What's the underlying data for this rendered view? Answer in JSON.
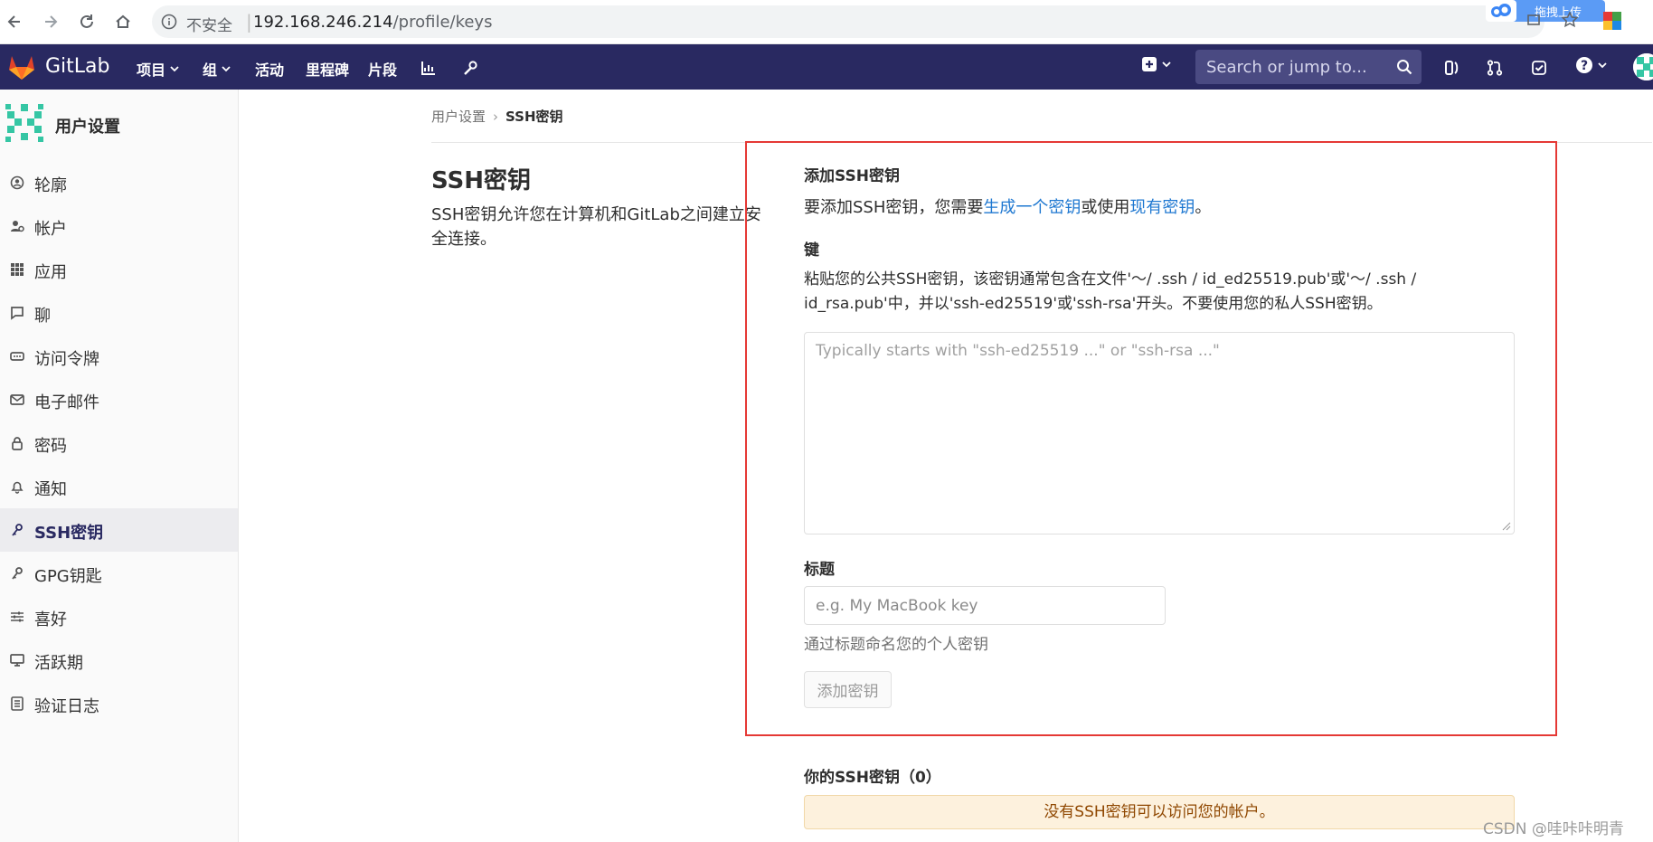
{
  "browser": {
    "security_label": "不安全",
    "url_host": "192.168.246.214",
    "url_path": "/profile/keys",
    "upload_badge": "拖拽上传"
  },
  "navbar": {
    "brand": "GitLab",
    "menu": [
      {
        "label": "项目",
        "has_dropdown": true
      },
      {
        "label": "组",
        "has_dropdown": true
      },
      {
        "label": "活动",
        "has_dropdown": false
      },
      {
        "label": "里程碑",
        "has_dropdown": false
      },
      {
        "label": "片段",
        "has_dropdown": false
      }
    ],
    "search_placeholder": "Search or jump to...",
    "colors": {
      "navbar_bg": "#292961",
      "search_bg": "#4a4a82"
    }
  },
  "sidebar": {
    "title": "用户设置",
    "items": [
      {
        "label": "轮廓",
        "icon": "profile-icon"
      },
      {
        "label": "帐户",
        "icon": "account-gear-icon"
      },
      {
        "label": "应用",
        "icon": "applications-grid-icon"
      },
      {
        "label": "聊",
        "icon": "chat-icon"
      },
      {
        "label": "访问令牌",
        "icon": "token-icon"
      },
      {
        "label": "电子邮件",
        "icon": "mail-icon"
      },
      {
        "label": "密码",
        "icon": "lock-icon"
      },
      {
        "label": "通知",
        "icon": "bell-icon"
      },
      {
        "label": "SSH密钥",
        "icon": "key-icon",
        "active": true
      },
      {
        "label": "GPG钥匙",
        "icon": "key-icon"
      },
      {
        "label": "喜好",
        "icon": "preferences-sliders-icon"
      },
      {
        "label": "活跃期",
        "icon": "monitor-icon"
      },
      {
        "label": "验证日志",
        "icon": "log-list-icon"
      }
    ]
  },
  "breadcrumb": {
    "parent": "用户设置",
    "current": "SSH密钥"
  },
  "page": {
    "title": "SSH密钥",
    "description": "SSH密钥允许您在计算机和GitLab之间建立安全连接。"
  },
  "form": {
    "add_heading": "添加SSH密钥",
    "add_desc_prefix": "要添加SSH密钥，您需要",
    "add_desc_link1": "生成一个密钥",
    "add_desc_middle": "或使用",
    "add_desc_link2": "现有密钥",
    "add_desc_suffix": "。",
    "key_heading": "键",
    "key_desc": "粘贴您的公共SSH密钥，该密钥通常包含在文件'〜/ .ssh / id_ed25519.pub'或'〜/ .ssh / id_rsa.pub'中，并以'ssh-ed25519'或'ssh-rsa'开头。不要使用您的私人SSH密钥。",
    "key_placeholder": "Typically starts with \"ssh-ed25519 ...\" or \"ssh-rsa ...\"",
    "title_heading": "标题",
    "title_placeholder": "e.g. My MacBook key",
    "title_help": "通过标题命名您的个人密钥",
    "submit_label": "添加密钥"
  },
  "keys_list": {
    "heading": "你的SSH密钥（0）",
    "empty_message": "没有SSH密钥可以访问您的帐户。"
  },
  "watermark": "CSDN @哇咔咔明青",
  "highlight_color": "#e53935"
}
